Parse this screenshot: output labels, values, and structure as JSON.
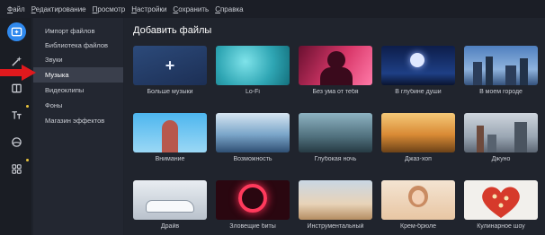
{
  "menu": [
    "Файл",
    "Редактирование",
    "Просмотр",
    "Настройки",
    "Сохранить",
    "Справка"
  ],
  "sidebar": {
    "items": [
      {
        "label": "Импорт файлов",
        "active": false
      },
      {
        "label": "Библиотека файлов",
        "active": false
      },
      {
        "label": "Звуки",
        "active": false
      },
      {
        "label": "Музыка",
        "active": true
      },
      {
        "label": "Видеоклипы",
        "active": false
      },
      {
        "label": "Фоны",
        "active": false
      },
      {
        "label": "Магазин эффектов",
        "active": false
      }
    ]
  },
  "main": {
    "title": "Добавить файлы",
    "tiles": [
      {
        "label": "Больше музыки",
        "theme": "more",
        "plus": "+"
      },
      {
        "label": "Lo-Fi",
        "theme": "teal"
      },
      {
        "label": "Без ума от тебя",
        "theme": "pink"
      },
      {
        "label": "В глубине души",
        "theme": "night"
      },
      {
        "label": "В моем городе",
        "theme": "city"
      },
      {
        "label": "Внимание",
        "theme": "sky"
      },
      {
        "label": "Возможность",
        "theme": "lake"
      },
      {
        "label": "Глубокая ночь",
        "theme": "forest"
      },
      {
        "label": "Джаз-хоп",
        "theme": "field"
      },
      {
        "label": "Джуно",
        "theme": "skyline"
      },
      {
        "label": "Драйв",
        "theme": "car"
      },
      {
        "label": "Зловещие биты",
        "theme": "ring"
      },
      {
        "label": "Инструментальный",
        "theme": "desert"
      },
      {
        "label": "Крем-брюле",
        "theme": "girl"
      },
      {
        "label": "Кулинарное шоу",
        "theme": "pizza"
      }
    ]
  },
  "colors": {
    "rail_active": "#2f89ee",
    "highlight_arrow": "#e0191d",
    "badge_dot": "#e9c33b"
  }
}
